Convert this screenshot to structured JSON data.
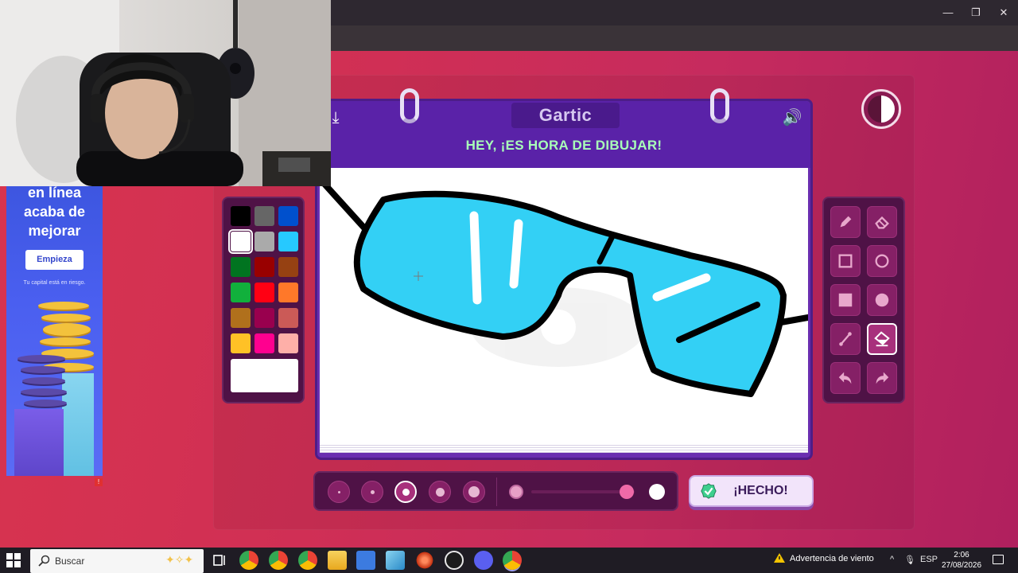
{
  "browser": {
    "window_controls": {
      "minimize": "—",
      "restore": "❐",
      "close": "✕"
    },
    "icons": [
      "star-icon",
      "profile-avatar",
      "kebab-menu-icon"
    ]
  },
  "ad": {
    "headline_lines": [
      "en línea",
      "acaba de",
      "mejorar"
    ],
    "cta_label": "Empieza",
    "disclaimer": "Tu capital está en riesgo.",
    "flag": "!"
  },
  "palette": {
    "colors": [
      [
        "#000000",
        "#666666",
        "#0050cd"
      ],
      [
        "#ffffff",
        "#aaaaaa",
        "#26c9ff"
      ],
      [
        "#017420",
        "#990000",
        "#964112"
      ],
      [
        "#11b03c",
        "#ff0013",
        "#ff7829"
      ],
      [
        "#b0701c",
        "#99004e",
        "#cb5a57"
      ],
      [
        "#ffc126",
        "#ff008f",
        "#feafa8"
      ]
    ],
    "selected": "#ffffff"
  },
  "board": {
    "logo": "Gartic",
    "banner": "HEY, ¡ES HORA DE DIBUJAR!",
    "icons": [
      "download-icon",
      "speaker-icon"
    ]
  },
  "tools": [
    "pencil",
    "eraser",
    "rectangle-outline",
    "ellipse-outline",
    "rectangle-filled",
    "ellipse-filled",
    "line",
    "fill-bucket",
    "undo",
    "redo"
  ],
  "active_tool": "fill-bucket",
  "brush": {
    "sizes": [
      "size-1",
      "size-2",
      "size-3",
      "size-4",
      "size-5"
    ],
    "active_size": "size-3",
    "opacity_level": 0.92
  },
  "done_button": {
    "label": "¡HECHO!"
  },
  "taskbar": {
    "search_placeholder": "Buscar",
    "weather": "Advertencia de viento",
    "language": "ESP",
    "time": "2:06",
    "date": "27/08/2026"
  },
  "colors": {
    "page_bg": "#d02f55",
    "board": "#6a2eb0",
    "panel": "#4f1246",
    "banner_text": "#a8ffb8",
    "drawing_fill": "#33d0f5"
  }
}
